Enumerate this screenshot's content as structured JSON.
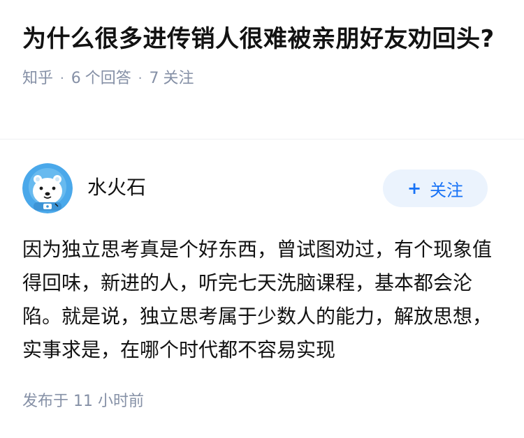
{
  "question": {
    "title": "为什么很多进传销人很难被亲朋好友劝回头?",
    "source": "知乎",
    "answer_count": "6",
    "answer_label": "个回答",
    "follow_count": "7",
    "follow_label": "关注"
  },
  "answer": {
    "author": {
      "name": "水火石",
      "avatar_icon": "polar-bear-astronaut-avatar"
    },
    "follow_button": {
      "plus": "+",
      "label": "关注"
    },
    "content": "因为独立思考真是个好东西，曾试图劝过，有个现象值得回味，新进的人，听完七天洗脑课程，基本都会沦陷。就是说，独立思考属于少数人的能力，解放思想，实事求是，在哪个时代都不容易实现",
    "publish_time": "发布于 11 小时前"
  },
  "colors": {
    "meta_gray": "#8590a6",
    "accent_blue": "#1772f6",
    "follow_bg": "#ebf3fd",
    "avatar_blue": "#4aa8ea"
  }
}
